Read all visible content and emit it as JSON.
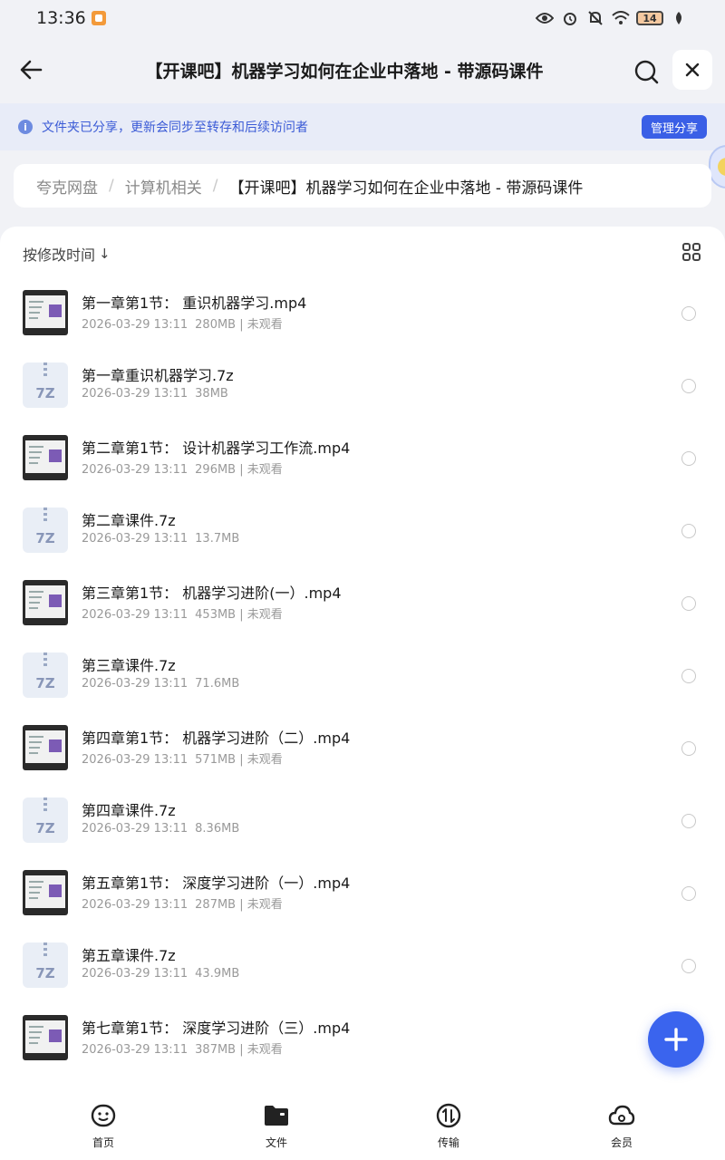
{
  "status_bar": {
    "time": "13:36",
    "battery": "14",
    "icons": [
      "eye-icon",
      "alarm-icon",
      "mute-icon",
      "wifi-icon",
      "leaf-icon"
    ]
  },
  "header": {
    "title": "【开课吧】机器学习如何在企业中落地 - 带源码课件"
  },
  "notice": {
    "text": "文件夹已分享，更新会同步至转存和后续访问者",
    "button": "管理分享"
  },
  "breadcrumb": {
    "items": [
      "夸克网盘",
      "计算机相关"
    ],
    "current": "【开课吧】机器学习如何在企业中落地 - 带源码课件"
  },
  "sort": {
    "label": "按修改时间"
  },
  "files": [
    {
      "name": "第一章第1节： 重识机器学习.mp4",
      "date": "2026-03-29 13:11",
      "size": "280MB",
      "extra": "未观看",
      "kind": "video"
    },
    {
      "name": "第一章重识机器学习.7z",
      "date": "2026-03-29 13:11",
      "size": "38MB",
      "extra": "",
      "kind": "zip"
    },
    {
      "name": "第二章第1节： 设计机器学习工作流.mp4",
      "date": "2026-03-29 13:11",
      "size": "296MB",
      "extra": "未观看",
      "kind": "video"
    },
    {
      "name": "第二章课件.7z",
      "date": "2026-03-29 13:11",
      "size": "13.7MB",
      "extra": "",
      "kind": "zip"
    },
    {
      "name": "第三章第1节： 机器学习进阶(一）.mp4",
      "date": "2026-03-29 13:11",
      "size": "453MB",
      "extra": "未观看",
      "kind": "video"
    },
    {
      "name": "第三章课件.7z",
      "date": "2026-03-29 13:11",
      "size": "71.6MB",
      "extra": "",
      "kind": "zip"
    },
    {
      "name": "第四章第1节： 机器学习进阶（二）.mp4",
      "date": "2026-03-29 13:11",
      "size": "571MB",
      "extra": "未观看",
      "kind": "video"
    },
    {
      "name": "第四章课件.7z",
      "date": "2026-03-29 13:11",
      "size": "8.36MB",
      "extra": "",
      "kind": "zip"
    },
    {
      "name": "第五章第1节： 深度学习进阶（一）.mp4",
      "date": "2026-03-29 13:11",
      "size": "287MB",
      "extra": "未观看",
      "kind": "video"
    },
    {
      "name": "第五章课件.7z",
      "date": "2026-03-29 13:11",
      "size": "43.9MB",
      "extra": "",
      "kind": "zip"
    },
    {
      "name": "第七章第1节： 深度学习进阶（三）.mp4",
      "date": "2026-03-29 13:11",
      "size": "387MB",
      "extra": "未观看",
      "kind": "video"
    }
  ],
  "zip_label": "7Z",
  "tabs": [
    {
      "label": "首页",
      "icon": "home-smile-icon"
    },
    {
      "label": "文件",
      "icon": "folder-icon"
    },
    {
      "label": "传输",
      "icon": "transfer-icon"
    },
    {
      "label": "会员",
      "icon": "cloud-member-icon"
    }
  ],
  "colors": {
    "accent": "#3a64ee",
    "notice_bg": "#e8ecf8",
    "notice_text": "#3b5bd6"
  }
}
